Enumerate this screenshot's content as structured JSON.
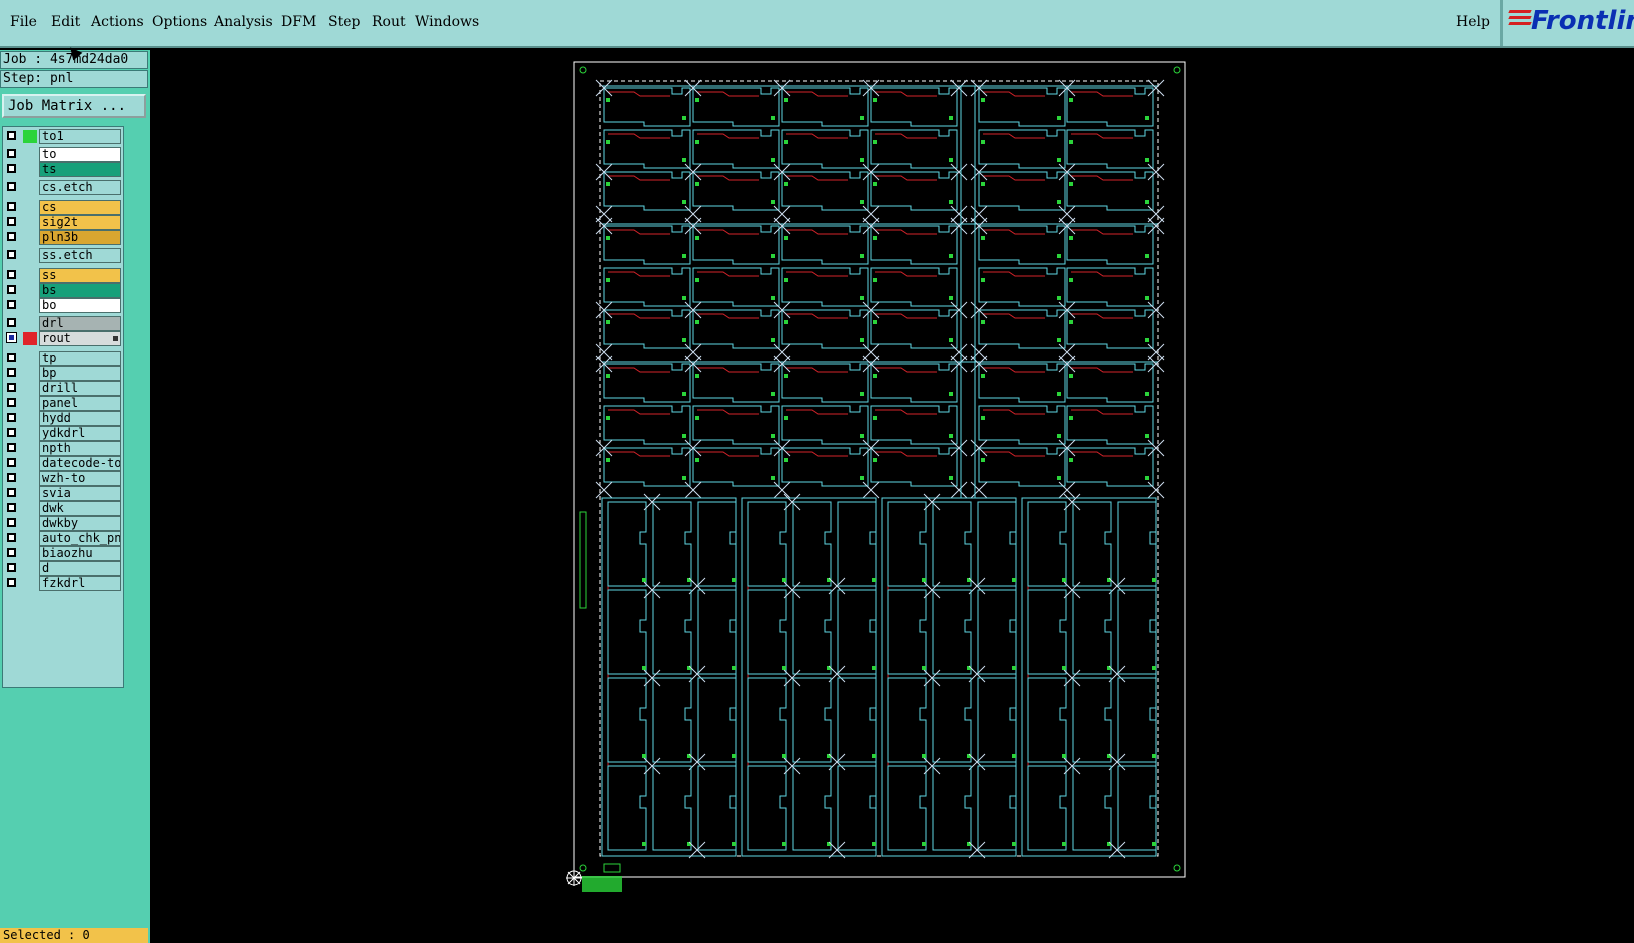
{
  "menubar": {
    "items": [
      {
        "label": "File",
        "name": "menu-file"
      },
      {
        "label": "Edit",
        "name": "menu-edit"
      },
      {
        "label": "Actions",
        "name": "menu-actions"
      },
      {
        "label": "Options",
        "name": "menu-options"
      },
      {
        "label": "Analysis",
        "name": "menu-analysis"
      },
      {
        "label": "DFM",
        "name": "menu-dfm"
      },
      {
        "label": "Step",
        "name": "menu-step"
      },
      {
        "label": "Rout",
        "name": "menu-rout"
      },
      {
        "label": "Windows",
        "name": "menu-windows"
      }
    ],
    "help": "Help",
    "logo": "Frontline"
  },
  "job": {
    "job_line": "Job : 4s7md24da0",
    "step_line": "Step: pnl",
    "job_matrix_label": "Job Matrix ..."
  },
  "layers": [
    {
      "name": "to1",
      "bg": "#9fd9d6",
      "swatch": "#2bd43a",
      "checked": false
    },
    {
      "name": "to",
      "bg": "#ffffff",
      "swatch": "",
      "checked": false
    },
    {
      "name": "ts",
      "bg": "#17a07a",
      "swatch": "",
      "checked": false
    },
    {
      "name": "cs.etch",
      "bg": "#9fd9d6",
      "swatch": "",
      "checked": false
    },
    {
      "name": "cs",
      "bg": "#f2c24a",
      "swatch": "",
      "checked": false
    },
    {
      "name": "sig2t",
      "bg": "#f2c24a",
      "swatch": "",
      "checked": false
    },
    {
      "name": "pln3b",
      "bg": "#d9a630",
      "swatch": "",
      "checked": false
    },
    {
      "name": "ss.etch",
      "bg": "#9fd9d6",
      "swatch": "",
      "checked": false
    },
    {
      "name": "ss",
      "bg": "#f2c24a",
      "swatch": "",
      "checked": false
    },
    {
      "name": "bs",
      "bg": "#17a07a",
      "swatch": "",
      "checked": false
    },
    {
      "name": "bo",
      "bg": "#ffffff",
      "swatch": "",
      "checked": false
    },
    {
      "name": "drl",
      "bg": "#a6b3b2",
      "swatch": "",
      "checked": false
    },
    {
      "name": "rout",
      "bg": "#d7dcdc",
      "swatch": "#e0242a",
      "checked": true
    },
    {
      "name": "tp",
      "bg": "#9fd9d6",
      "swatch": "",
      "checked": false
    },
    {
      "name": "bp",
      "bg": "#9fd9d6",
      "swatch": "",
      "checked": false
    },
    {
      "name": "drill",
      "bg": "#9fd9d6",
      "swatch": "",
      "checked": false
    },
    {
      "name": "panel",
      "bg": "#9fd9d6",
      "swatch": "",
      "checked": false
    },
    {
      "name": "hydd",
      "bg": "#9fd9d6",
      "swatch": "",
      "checked": false
    },
    {
      "name": "ydkdrl",
      "bg": "#9fd9d6",
      "swatch": "",
      "checked": false
    },
    {
      "name": "npth",
      "bg": "#9fd9d6",
      "swatch": "",
      "checked": false
    },
    {
      "name": "datecode-to",
      "bg": "#9fd9d6",
      "swatch": "",
      "checked": false
    },
    {
      "name": "wzh-to",
      "bg": "#9fd9d6",
      "swatch": "",
      "checked": false
    },
    {
      "name": "svia",
      "bg": "#9fd9d6",
      "swatch": "",
      "checked": false
    },
    {
      "name": "dwk",
      "bg": "#9fd9d6",
      "swatch": "",
      "checked": false
    },
    {
      "name": "dwkby",
      "bg": "#9fd9d6",
      "swatch": "",
      "checked": false
    },
    {
      "name": "auto_chk_pnl",
      "bg": "#9fd9d6",
      "swatch": "",
      "checked": false
    },
    {
      "name": "biaozhu",
      "bg": "#9fd9d6",
      "swatch": "",
      "checked": false
    },
    {
      "name": "d",
      "bg": "#9fd9d6",
      "swatch": "",
      "checked": false
    },
    {
      "name": "fzkdrl",
      "bg": "#9fd9d6",
      "swatch": "",
      "checked": false
    }
  ],
  "status": {
    "selected": "Selected : 0"
  },
  "colors": {
    "outline": "#5fd7e3",
    "route": "#d4232a",
    "pad": "#2bd43a",
    "frame": "#ffffff"
  }
}
